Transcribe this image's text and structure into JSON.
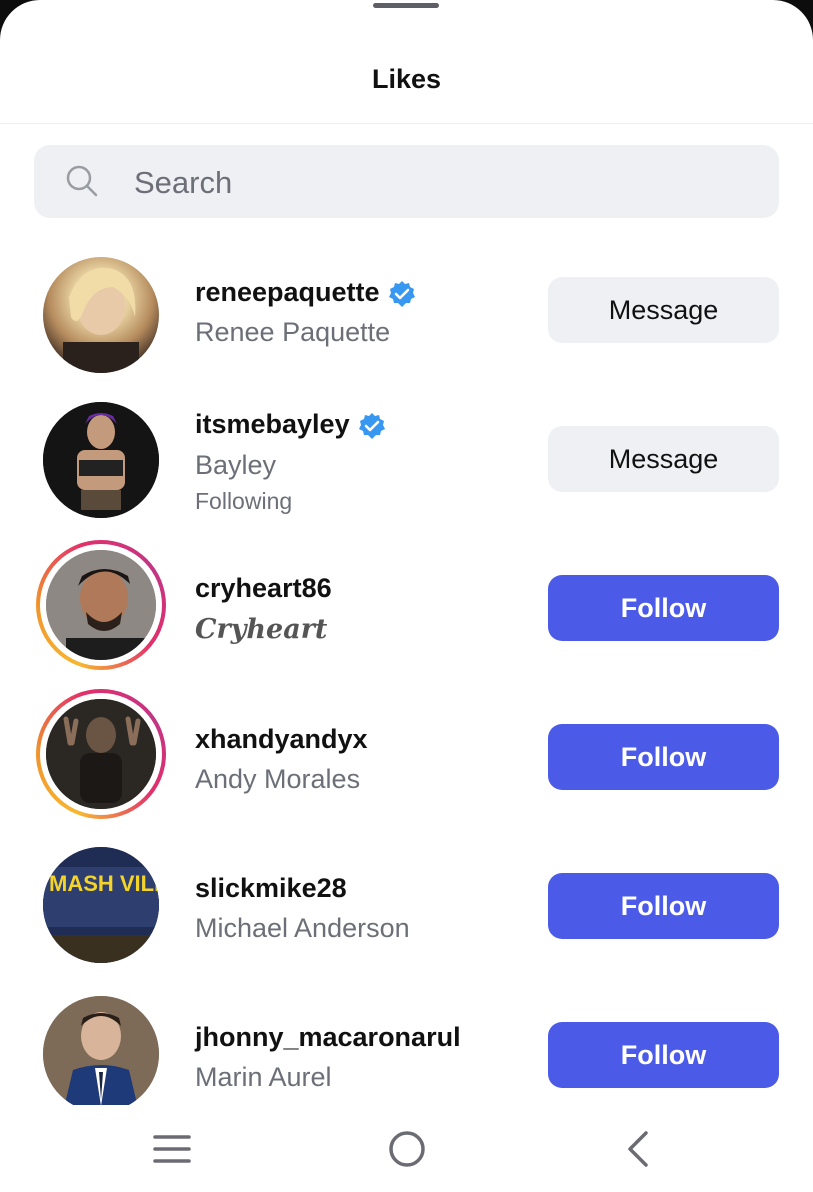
{
  "header": {
    "title": "Likes"
  },
  "search": {
    "placeholder": "Search"
  },
  "colors": {
    "follow_button": "#4b5be8",
    "message_button": "#eef0f4",
    "verified_badge": "#3897f0"
  },
  "users": [
    {
      "username": "reneepaquette",
      "full_name": "Renee Paquette",
      "verified": true,
      "subtitle": "",
      "button": "Message",
      "story_ring": false
    },
    {
      "username": "itsmebayley",
      "full_name": "Bayley",
      "verified": true,
      "subtitle": "Following",
      "button": "Message",
      "story_ring": false
    },
    {
      "username": "cryheart86",
      "full_name": "Cryheart",
      "verified": false,
      "subtitle": "",
      "button": "Follow",
      "story_ring": true
    },
    {
      "username": "xhandyandyx",
      "full_name": "Andy Morales",
      "verified": false,
      "subtitle": "",
      "button": "Follow",
      "story_ring": true
    },
    {
      "username": "slickmike28",
      "full_name": "Michael Anderson",
      "verified": false,
      "subtitle": "",
      "button": "Follow",
      "story_ring": false
    },
    {
      "username": "jhonny_macaronarul",
      "full_name": "Marin Aurel",
      "verified": false,
      "subtitle": "",
      "button": "Follow",
      "story_ring": false
    }
  ],
  "nav": {
    "menu_icon": "menu-icon",
    "home_icon": "home-icon",
    "back_icon": "back-icon"
  },
  "avatar_art": {
    "slickmike28": "MASH VILLE"
  }
}
